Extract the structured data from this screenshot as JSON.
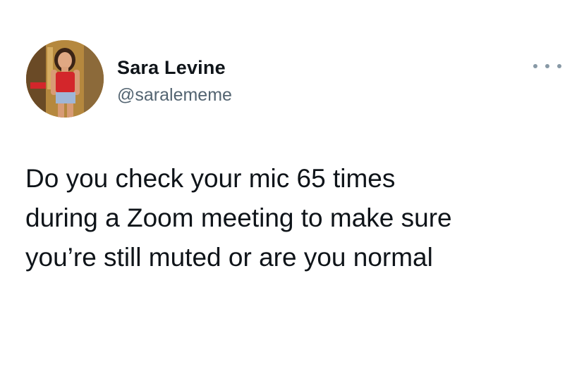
{
  "author": {
    "display_name": "Sara Levine",
    "handle": "@saralememe"
  },
  "tweet": {
    "text_lines": [
      "Do you check your mic 65 times",
      "during a Zoom meeting to make sure",
      "you’re still muted or are you normal"
    ]
  },
  "icons": {
    "more": "more-options-icon"
  },
  "colors": {
    "name": "#0f1419",
    "handle": "#536471",
    "dots": "#8899a6",
    "background": "#ffffff"
  }
}
